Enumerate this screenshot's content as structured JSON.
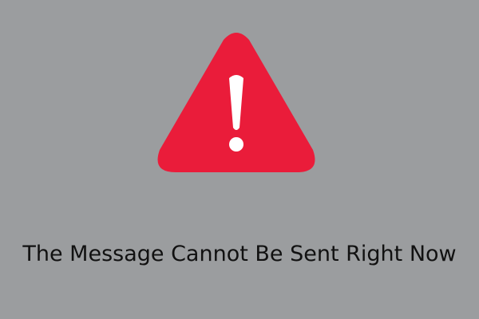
{
  "background_color": "#9b9d9f",
  "icon": {
    "name": "warning-triangle-icon",
    "color": "#ea1c3a",
    "glyph_color": "#ffffff"
  },
  "message": {
    "text": "The Message Cannot Be Sent Right Now",
    "color": "#111111"
  }
}
